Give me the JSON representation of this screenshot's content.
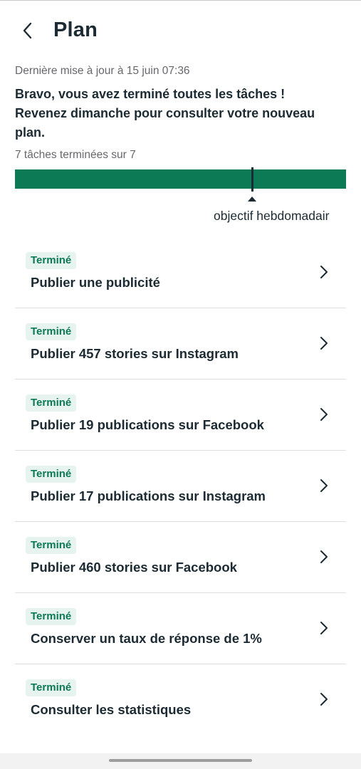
{
  "header": {
    "title": "Plan",
    "back_icon": "chevron-left-icon"
  },
  "status": {
    "updated": "Dernière mise à jour à 15 juin 07:36",
    "message": "Bravo, vous avez terminé toutes les tâches ! Revenez dimanche pour consulter votre nouveau plan.",
    "count": "7 tâches terminées sur 7"
  },
  "progress": {
    "completed": 7,
    "total": 7,
    "goal_label": "objectif hebdomadair",
    "fill_color": "#0b7a55"
  },
  "tasks": [
    {
      "status": "Terminé",
      "title": "Publier une publicité"
    },
    {
      "status": "Terminé",
      "title": "Publier 457 stories sur Instagram"
    },
    {
      "status": "Terminé",
      "title": "Publier 19 publications sur Facebook"
    },
    {
      "status": "Terminé",
      "title": "Publier 17 publications sur Instagram"
    },
    {
      "status": "Terminé",
      "title": "Publier 460 stories sur Facebook"
    },
    {
      "status": "Terminé",
      "title": "Conserver un taux de réponse de 1%"
    },
    {
      "status": "Terminé",
      "title": "Consulter les statistiques"
    }
  ],
  "colors": {
    "accent_green": "#0b7a55",
    "badge_bg": "#e7f3ee",
    "text": "#1c2b33",
    "muted_text": "#65676b"
  }
}
